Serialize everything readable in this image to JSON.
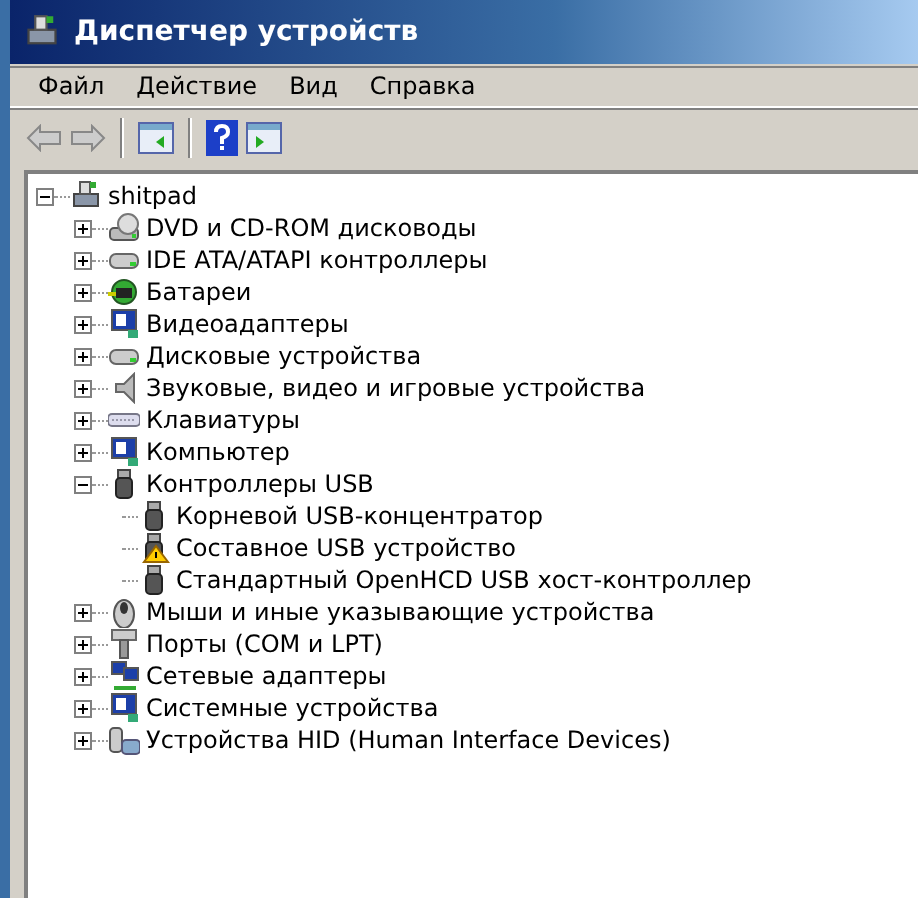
{
  "window": {
    "title": "Диспетчер устройств"
  },
  "menu": [
    "Файл",
    "Действие",
    "Вид",
    "Справка"
  ],
  "tree": {
    "label": "shitpad",
    "expanded": true,
    "children": [
      {
        "label": "DVD и CD-ROM дисководы",
        "expanded": false
      },
      {
        "label": "IDE ATA/ATAPI контроллеры",
        "expanded": false
      },
      {
        "label": "Батареи",
        "expanded": false
      },
      {
        "label": "Видеоадаптеры",
        "expanded": false
      },
      {
        "label": "Дисковые устройства",
        "expanded": false
      },
      {
        "label": "Звуковые, видео и игровые устройства",
        "expanded": false
      },
      {
        "label": "Клавиатуры",
        "expanded": false
      },
      {
        "label": "Компьютер",
        "expanded": false
      },
      {
        "label": "Контроллеры USB",
        "expanded": true,
        "children": [
          {
            "label": "Корневой USB-концентратор",
            "warning": false
          },
          {
            "label": "Составное USB устройство",
            "warning": true
          },
          {
            "label": "Стандартный OpenHCD USB хост-контроллер",
            "warning": false
          }
        ]
      },
      {
        "label": "Мыши и иные указывающие устройства",
        "expanded": false
      },
      {
        "label": "Порты (COM и LPT)",
        "expanded": false
      },
      {
        "label": "Сетевые адаптеры",
        "expanded": false
      },
      {
        "label": "Системные устройства",
        "expanded": false
      },
      {
        "label": "Устройства HID (Human Interface Devices)",
        "expanded": false
      }
    ]
  }
}
